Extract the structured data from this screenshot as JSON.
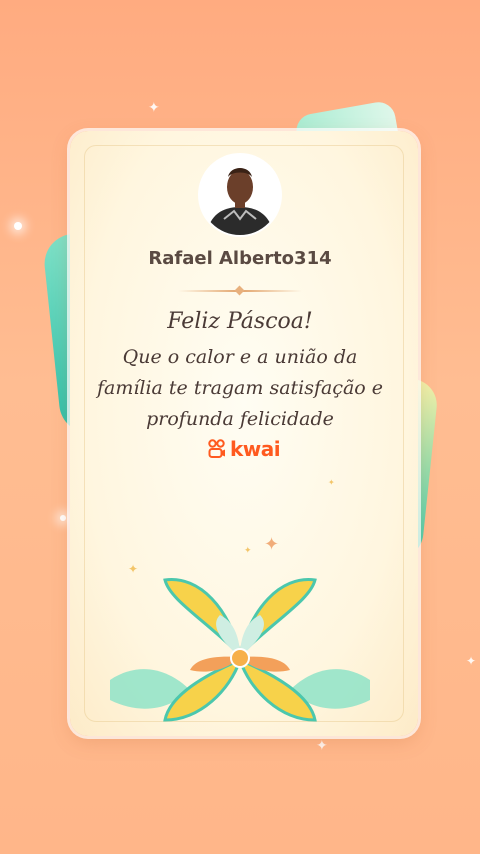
{
  "profile": {
    "username": "Rafael Alberto314"
  },
  "message": {
    "title": "Feliz Páscoa!",
    "lines": [
      "Que o calor e a união da",
      "família te tragam satisfação e",
      "profunda felicidade"
    ]
  },
  "brand": {
    "name": "kwai",
    "color": "#ff5a1f"
  },
  "colors": {
    "background": "#ffb689",
    "card": "#fff6df",
    "ribbon_teal": "#2bbfa8",
    "flower_yellow": "#f7d24a"
  }
}
